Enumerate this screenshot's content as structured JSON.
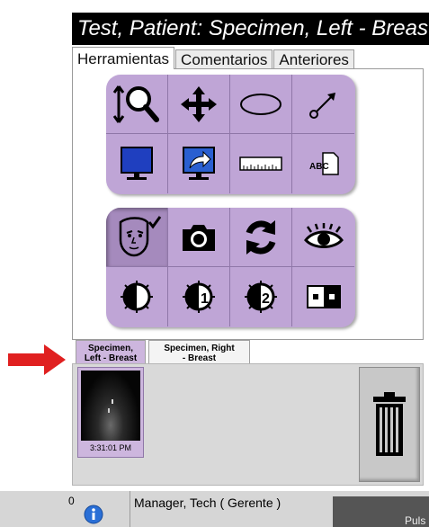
{
  "title": "Test, Patient:  Specimen, Left - Breast",
  "tabs": [
    "Herramientas",
    "Comentarios",
    "Anteriores"
  ],
  "tool_icons": [
    "zoom-icon",
    "pan-icon",
    "ellipse-icon",
    "arrow-annotation-icon",
    "monitor-icon",
    "send-to-monitor-icon",
    "ruler-icon",
    "text-annotation-icon"
  ],
  "view_icons": [
    "patient-face-check-icon",
    "camera-icon",
    "refresh-icon",
    "eye-icon",
    "invert-contrast-icon",
    "contrast-preset-1-icon",
    "contrast-preset-2-icon",
    "pixel-display-icon"
  ],
  "specimen_tabs": [
    {
      "label": "Specimen,\nLeft - Breast"
    },
    {
      "label": "Specimen, Right\n- Breast"
    }
  ],
  "thumbnail": {
    "time": "3:31:01 PM"
  },
  "status": {
    "number": "0",
    "user": "Manager, Tech ( Gerente )",
    "right_text": "Puls"
  }
}
